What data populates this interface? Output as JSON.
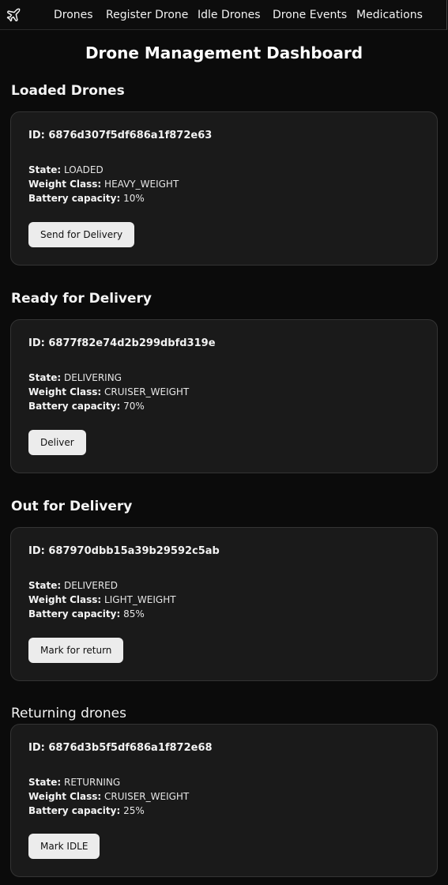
{
  "nav": {
    "logo_icon": "airplane-icon",
    "links": [
      "Drones",
      "Register Drone",
      "Idle Drones",
      "Drone Events",
      "Medications"
    ]
  },
  "page_title": "Drone Management Dashboard",
  "sections": [
    {
      "title": "Loaded Drones",
      "drone": {
        "id_label": "ID:",
        "id": "6876d307f5df686a1f872e63",
        "state_label": "State:",
        "state": "LOADED",
        "weight_label": "Weight Class:",
        "weight": "HEAVY_WEIGHT",
        "battery_label": "Battery capacity:",
        "battery": "10%"
      },
      "action": "Send for Delivery"
    },
    {
      "title": "Ready for Delivery",
      "drone": {
        "id_label": "ID:",
        "id": "6877f82e74d2b299dbfd319e",
        "state_label": "State:",
        "state": "DELIVERING",
        "weight_label": "Weight Class:",
        "weight": "CRUISER_WEIGHT",
        "battery_label": "Battery capacity:",
        "battery": "70%"
      },
      "action": "Deliver"
    },
    {
      "title": "Out for Delivery",
      "drone": {
        "id_label": "ID:",
        "id": "687970dbb15a39b29592c5ab",
        "state_label": "State:",
        "state": "DELIVERED",
        "weight_label": "Weight Class:",
        "weight": "LIGHT_WEIGHT",
        "battery_label": "Battery capacity:",
        "battery": "85%"
      },
      "action": "Mark for return"
    },
    {
      "title": "Returning drones",
      "drone": {
        "id_label": "ID:",
        "id": "6876d3b5f5df686a1f872e68",
        "state_label": "State:",
        "state": "RETURNING",
        "weight_label": "Weight Class:",
        "weight": "CRUISER_WEIGHT",
        "battery_label": "Battery capacity:",
        "battery": "25%"
      },
      "action": "Mark IDLE"
    }
  ]
}
